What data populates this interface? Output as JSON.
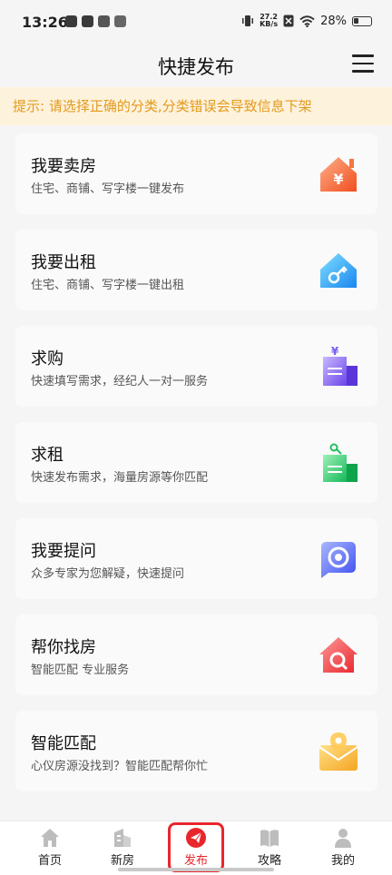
{
  "status_bar": {
    "time": "13:26",
    "net_speed_value": "27.2",
    "net_speed_unit": "KB/s",
    "battery": "28%"
  },
  "header": {
    "title": "快捷发布",
    "menu_icon": "hamburger-menu-icon"
  },
  "notice": {
    "text": "提示: 请选择正确的分类,分类错误会导致信息下架",
    "color": "#e49a1c",
    "background": "#fdf2dc"
  },
  "cards": [
    {
      "title": "我要卖房",
      "subtitle": "住宅、商铺、写字楼一键发布",
      "icon": "house-yuan-icon"
    },
    {
      "title": "我要出租",
      "subtitle": "住宅、商铺、写字楼一键出租",
      "icon": "house-key-icon"
    },
    {
      "title": "求购",
      "subtitle": "快速填写需求，经纪人一对一服务",
      "icon": "building-yuan-icon"
    },
    {
      "title": "求租",
      "subtitle": "快速发布需求，海量房源等你匹配",
      "icon": "building-key-icon"
    },
    {
      "title": "我要提问",
      "subtitle": "众多专家为您解疑，快速提问",
      "icon": "question-bubble-icon"
    },
    {
      "title": "帮你找房",
      "subtitle": "智能匹配 专业服务",
      "icon": "house-search-icon"
    },
    {
      "title": "智能匹配",
      "subtitle": "心仪房源没找到？智能匹配帮你忙",
      "icon": "envelope-pin-icon"
    }
  ],
  "tabbar": {
    "items": [
      {
        "label": "首页",
        "icon": "home-icon"
      },
      {
        "label": "新房",
        "icon": "building-icon"
      },
      {
        "label": "发布",
        "icon": "publish-icon"
      },
      {
        "label": "攻略",
        "icon": "book-icon"
      },
      {
        "label": "我的",
        "icon": "user-icon"
      }
    ],
    "active_index": 2,
    "active_color": "#e8262c"
  }
}
